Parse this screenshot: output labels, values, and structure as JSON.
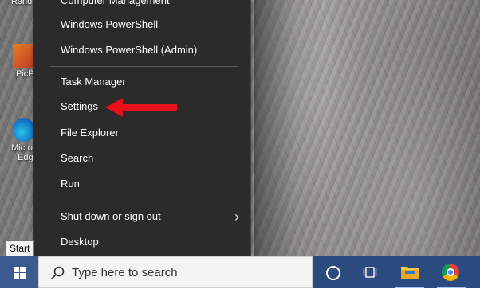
{
  "desktop": {
    "icons": [
      {
        "label": "Rand"
      },
      {
        "label": "PicP"
      },
      {
        "label": "Micro",
        "label2": "Edg"
      }
    ]
  },
  "context_menu": {
    "items": [
      {
        "label": "Computer Management"
      },
      {
        "label": "Windows PowerShell"
      },
      {
        "label": "Windows PowerShell (Admin)"
      },
      {
        "label": "Task Manager"
      },
      {
        "label": "Settings"
      },
      {
        "label": "File Explorer"
      },
      {
        "label": "Search"
      },
      {
        "label": "Run"
      },
      {
        "label": "Shut down or sign out",
        "submenu_glyph": "›"
      },
      {
        "label": "Desktop"
      }
    ]
  },
  "annotation": {
    "arrow_color": "#e8101a"
  },
  "start_tooltip": "Start",
  "taskbar": {
    "search_placeholder": "Type here to search",
    "color": "#2b4a7e",
    "icons": [
      "start-windows-icon",
      "cortana-icon",
      "task-view-icon",
      "file-explorer-icon",
      "chrome-icon"
    ]
  }
}
